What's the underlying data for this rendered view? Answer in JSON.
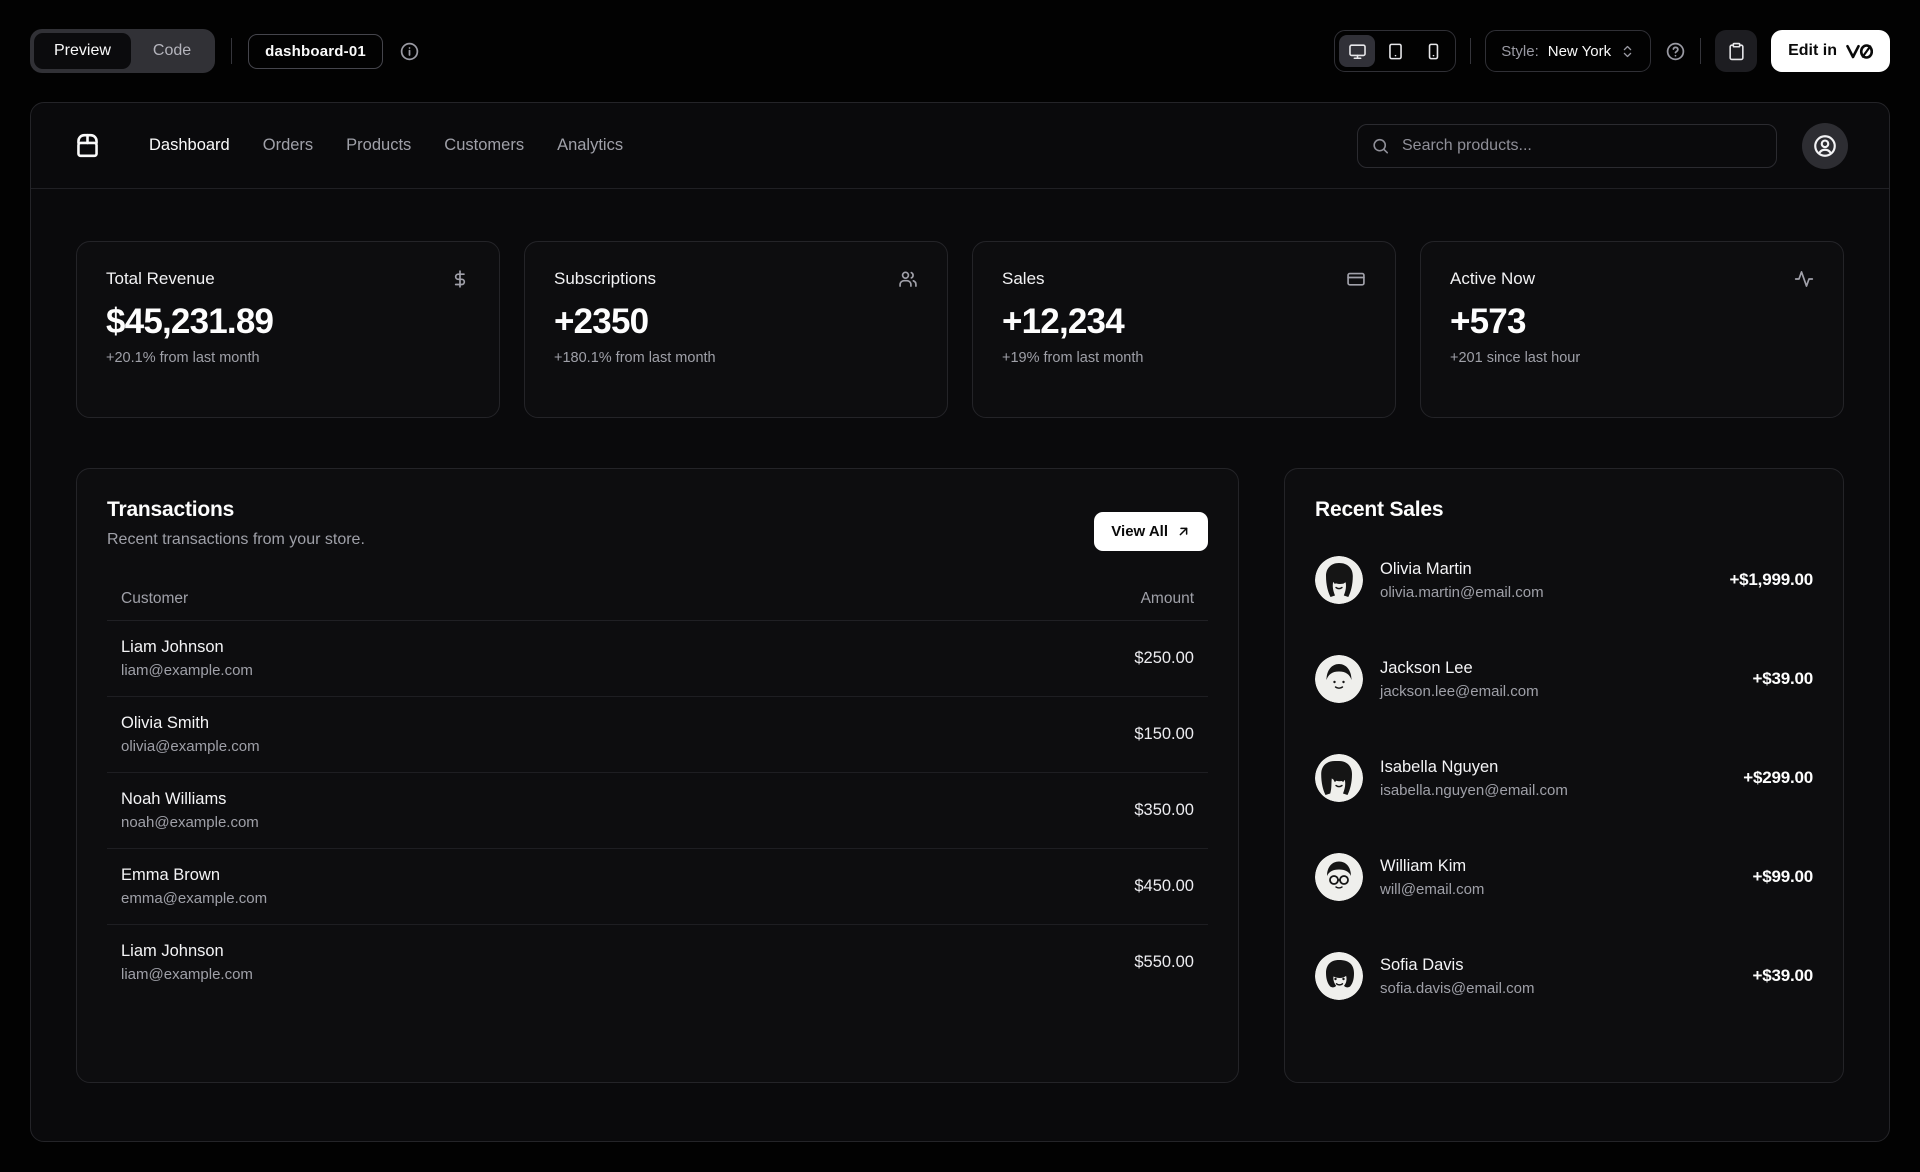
{
  "toolbar": {
    "view_tabs": [
      {
        "label": "Preview",
        "active": true
      },
      {
        "label": "Code",
        "active": false
      }
    ],
    "block_name": "dashboard-01",
    "style_label": "Style:",
    "style_value": "New York",
    "edit_button_label": "Edit in",
    "edit_button_logo": "v0",
    "device_icons": [
      "desktop-icon",
      "tablet-icon",
      "phone-icon"
    ]
  },
  "nav": {
    "items": [
      {
        "label": "Dashboard",
        "active": true
      },
      {
        "label": "Orders",
        "active": false
      },
      {
        "label": "Products",
        "active": false
      },
      {
        "label": "Customers",
        "active": false
      },
      {
        "label": "Analytics",
        "active": false
      }
    ],
    "search_placeholder": "Search products..."
  },
  "stats": [
    {
      "title": "Total Revenue",
      "value": "$45,231.89",
      "change": "+20.1% from last month",
      "icon": "dollar-sign-icon"
    },
    {
      "title": "Subscriptions",
      "value": "+2350",
      "change": "+180.1% from last month",
      "icon": "users-icon"
    },
    {
      "title": "Sales",
      "value": "+12,234",
      "change": "+19% from last month",
      "icon": "credit-card-icon"
    },
    {
      "title": "Active Now",
      "value": "+573",
      "change": "+201 since last hour",
      "icon": "activity-icon"
    }
  ],
  "transactions": {
    "title": "Transactions",
    "description": "Recent transactions from your store.",
    "view_all_label": "View All",
    "columns": [
      "Customer",
      "Amount"
    ],
    "rows": [
      {
        "name": "Liam Johnson",
        "email": "liam@example.com",
        "amount": "$250.00"
      },
      {
        "name": "Olivia Smith",
        "email": "olivia@example.com",
        "amount": "$150.00"
      },
      {
        "name": "Noah Williams",
        "email": "noah@example.com",
        "amount": "$350.00"
      },
      {
        "name": "Emma Brown",
        "email": "emma@example.com",
        "amount": "$450.00"
      },
      {
        "name": "Liam Johnson",
        "email": "liam@example.com",
        "amount": "$550.00"
      }
    ]
  },
  "recent_sales": {
    "title": "Recent Sales",
    "items": [
      {
        "name": "Olivia Martin",
        "email": "olivia.martin@email.com",
        "amount": "+$1,999.00"
      },
      {
        "name": "Jackson Lee",
        "email": "jackson.lee@email.com",
        "amount": "+$39.00"
      },
      {
        "name": "Isabella Nguyen",
        "email": "isabella.nguyen@email.com",
        "amount": "+$299.00"
      },
      {
        "name": "William Kim",
        "email": "will@email.com",
        "amount": "+$99.00"
      },
      {
        "name": "Sofia Davis",
        "email": "sofia.davis@email.com",
        "amount": "+$39.00"
      }
    ]
  },
  "colors": {
    "page_background": "#020202",
    "panel_background": "#0a0a0c",
    "card_background": "#0d0d0f",
    "border": "#242428",
    "muted_text": "#9fa0a8",
    "accent_button": "#ffffff"
  }
}
